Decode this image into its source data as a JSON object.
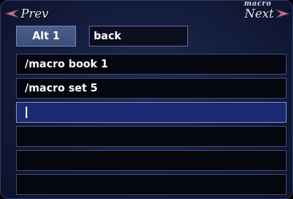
{
  "window": {
    "title": "macro"
  },
  "nav": {
    "prev_label": "Prev",
    "next_label": "Next"
  },
  "set_button": {
    "label": "Alt 1"
  },
  "macro_name": {
    "value": "back"
  },
  "lines": [
    {
      "text": "/macro book 1"
    },
    {
      "text": "/macro set 5"
    },
    {
      "text": ""
    },
    {
      "text": ""
    },
    {
      "text": ""
    },
    {
      "text": ""
    }
  ],
  "icons": {
    "prev": "left-arrow-icon",
    "next": "right-arrow-icon"
  },
  "colors": {
    "panel_bg": "#141c3c",
    "active_line": "#1b2a72",
    "button_bg": "#3b4e77",
    "arrow": "#b4788c"
  }
}
